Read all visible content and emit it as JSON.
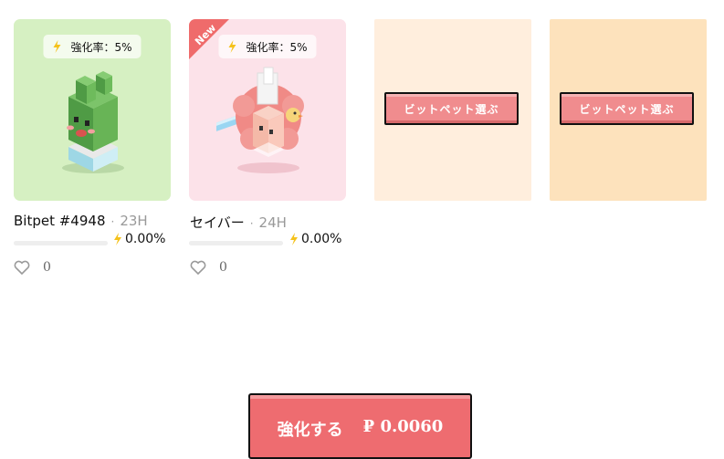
{
  "cards": [
    {
      "boost_label": "強化率：5%",
      "name": "Bitpet #4948",
      "separator": "·",
      "age": "23H",
      "percent": "0.00%",
      "progress": 0,
      "likes": "0"
    },
    {
      "new_badge": "New",
      "boost_label": "強化率：5%",
      "name": "セイバー",
      "separator": "·",
      "age": "24H",
      "percent": "0.00%",
      "progress": 0,
      "likes": "0"
    }
  ],
  "empty_slots": [
    {
      "button_label": "ビットペット選ぶ"
    },
    {
      "button_label": "ビットペット選ぶ"
    }
  ],
  "boost_button": {
    "label": "強化する",
    "price": "₽ 0.0060"
  },
  "colors": {
    "card1_bg": "#d6f0c2",
    "card2_bg": "#fce2e9",
    "slot3_bg": "#ffeedd",
    "slot4_bg": "#fde2bc",
    "accent": "#ee6c70",
    "bolt": "#f5c21b"
  },
  "icons": [
    "bolt-icon",
    "heart-icon"
  ]
}
